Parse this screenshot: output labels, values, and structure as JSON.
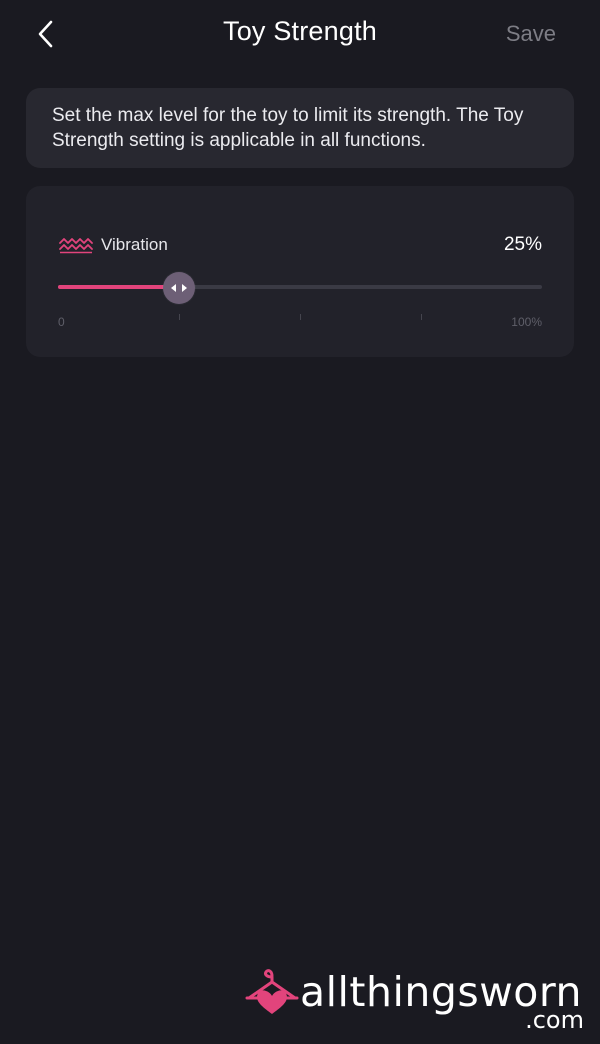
{
  "header": {
    "title": "Toy Strength",
    "save_label": "Save",
    "back_icon": "chevron-left-icon"
  },
  "info": {
    "text": "Set the max level for the toy to limit its strength. The Toy Strength setting is applicable in all functions."
  },
  "vibration": {
    "icon": "vibration-wave-icon",
    "label": "Vibration",
    "value_text": "25%",
    "level_fraction": 0.25,
    "scale_min": "0",
    "scale_max": "100%"
  },
  "watermark": {
    "brand": "allthingsworn",
    "suffix": ".com"
  },
  "colors": {
    "background": "#1a1a21",
    "accent": "#e2447c",
    "thumb": "#6d5f76",
    "save_disabled": "#7d7d85"
  }
}
